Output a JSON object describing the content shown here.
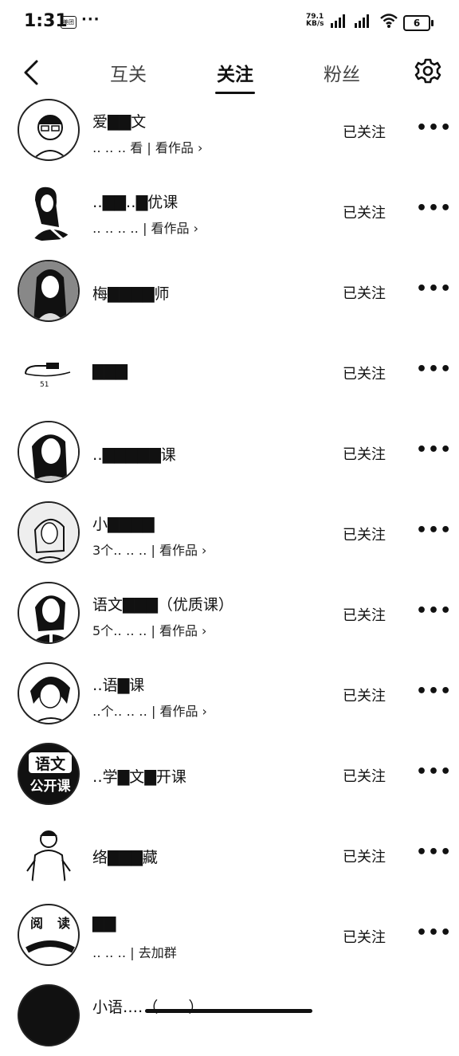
{
  "status_bar": {
    "time": "1:31",
    "app_badge": "美团",
    "overflow_dots": "···",
    "net_speed_top": "79.1",
    "net_speed_bottom": "KB/s",
    "battery": "6"
  },
  "header": {
    "tabs": [
      {
        "label": "互关"
      },
      {
        "label": "关注"
      },
      {
        "label": "粉丝"
      }
    ],
    "active_tab": "关注"
  },
  "list": [
    {
      "name": "爱▇▇文",
      "sub": "‥ ‥ ‥ 看 | 看作品 ›",
      "button": "已关注",
      "avatar_icon": "person-glasses-avatar"
    },
    {
      "name": "‥▇▇‥▇优课",
      "sub": "‥ ‥ ‥ ‥ | 看作品 ›",
      "button": "已关注",
      "avatar_icon": "woman-portrait-avatar"
    },
    {
      "name": "梅▇▇▇▇师",
      "sub": "",
      "button": "已关注",
      "avatar_icon": "woman-portrait-avatar"
    },
    {
      "name": "▇▇▇",
      "sub": "",
      "button": "已关注",
      "avatar_icon": "pen-logo-avatar",
      "avatar_text": "51"
    },
    {
      "name": "‥▇▇▇▇▇课",
      "sub": "",
      "button": "已关注",
      "avatar_icon": "woman-portrait-avatar"
    },
    {
      "name": "小▇▇▇▇",
      "sub": "3个‥ ‥ ‥ | 看作品 ›",
      "button": "已关注",
      "avatar_icon": "woman-portrait-avatar"
    },
    {
      "name": "语文▇▇▇（优质课）",
      "sub": "5个‥ ‥ ‥ | 看作品 ›",
      "button": "已关注",
      "avatar_icon": "woman-portrait-avatar"
    },
    {
      "name": "‥语▇课",
      "sub": "‥个‥ ‥ ‥ | 看作品 ›",
      "button": "已关注",
      "avatar_icon": "woman-portrait-avatar"
    },
    {
      "name": "‥学▇文▇开课",
      "sub": "",
      "button": "已关注",
      "avatar_icon": "text-logo-avatar",
      "avatar_text": [
        "语文",
        "公开课"
      ]
    },
    {
      "name": "络▇▇▇藏",
      "sub": "",
      "button": "已关注",
      "avatar_icon": "man-portrait-avatar"
    },
    {
      "name": "▇▇",
      "sub": "‥ ‥ ‥ | 去加群",
      "button": "已关注",
      "avatar_icon": "stamp-logo-avatar",
      "avatar_text": [
        "阅",
        "读"
      ]
    },
    {
      "name": "小语‥‥（‥‥‥）",
      "sub": "",
      "button": "",
      "avatar_icon": "partial-avatar"
    }
  ],
  "more_label": "•••"
}
